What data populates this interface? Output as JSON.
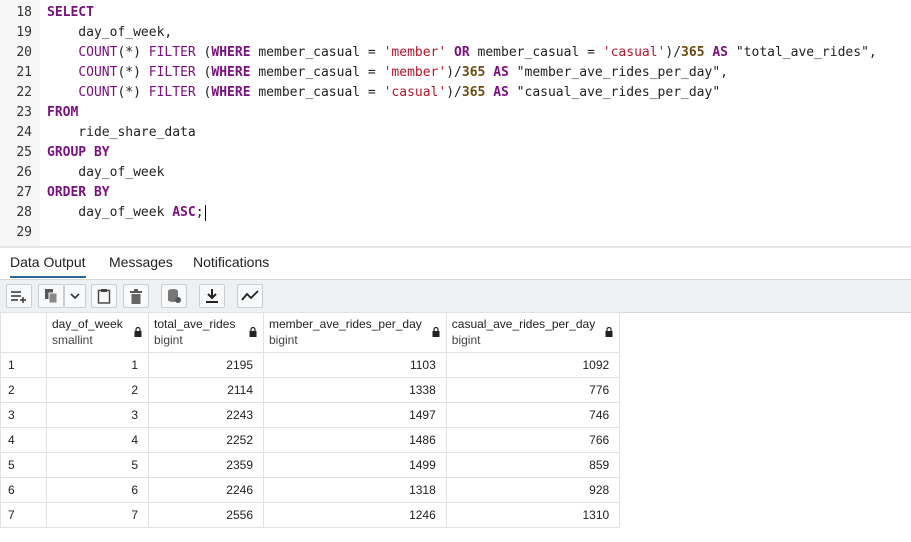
{
  "editor": {
    "lines": [
      {
        "n": "18",
        "parts": [
          {
            "t": "SELECT",
            "c": "kw"
          }
        ]
      },
      {
        "n": "19",
        "parts": [
          {
            "t": "    day_of_week,",
            "c": ""
          }
        ]
      },
      {
        "n": "20",
        "parts": [
          {
            "t": "    ",
            "c": ""
          },
          {
            "t": "COUNT",
            "c": "fn"
          },
          {
            "t": "(*) ",
            "c": ""
          },
          {
            "t": "FILTER",
            "c": "fn"
          },
          {
            "t": " (",
            "c": ""
          },
          {
            "t": "WHERE",
            "c": "kw"
          },
          {
            "t": " member_casual = ",
            "c": ""
          },
          {
            "t": "'member'",
            "c": "str"
          },
          {
            "t": " ",
            "c": ""
          },
          {
            "t": "OR",
            "c": "kw"
          },
          {
            "t": " member_casual = ",
            "c": ""
          },
          {
            "t": "'casual'",
            "c": "str"
          },
          {
            "t": ")/",
            "c": ""
          },
          {
            "t": "365",
            "c": "num"
          },
          {
            "t": " ",
            "c": ""
          },
          {
            "t": "AS",
            "c": "kw"
          },
          {
            "t": " \"total_ave_rides\",",
            "c": ""
          }
        ]
      },
      {
        "n": "21",
        "parts": [
          {
            "t": "    ",
            "c": ""
          },
          {
            "t": "COUNT",
            "c": "fn"
          },
          {
            "t": "(*) ",
            "c": ""
          },
          {
            "t": "FILTER",
            "c": "fn"
          },
          {
            "t": " (",
            "c": ""
          },
          {
            "t": "WHERE",
            "c": "kw"
          },
          {
            "t": " member_casual = ",
            "c": ""
          },
          {
            "t": "'member'",
            "c": "str"
          },
          {
            "t": ")/",
            "c": ""
          },
          {
            "t": "365",
            "c": "num"
          },
          {
            "t": " ",
            "c": ""
          },
          {
            "t": "AS",
            "c": "kw"
          },
          {
            "t": " \"member_ave_rides_per_day\",",
            "c": ""
          }
        ]
      },
      {
        "n": "22",
        "parts": [
          {
            "t": "    ",
            "c": ""
          },
          {
            "t": "COUNT",
            "c": "fn"
          },
          {
            "t": "(*) ",
            "c": ""
          },
          {
            "t": "FILTER",
            "c": "fn"
          },
          {
            "t": " (",
            "c": ""
          },
          {
            "t": "WHERE",
            "c": "kw"
          },
          {
            "t": " member_casual = ",
            "c": ""
          },
          {
            "t": "'casual'",
            "c": "str"
          },
          {
            "t": ")/",
            "c": ""
          },
          {
            "t": "365",
            "c": "num"
          },
          {
            "t": " ",
            "c": ""
          },
          {
            "t": "AS",
            "c": "kw"
          },
          {
            "t": " \"casual_ave_rides_per_day\"",
            "c": ""
          }
        ]
      },
      {
        "n": "23",
        "parts": [
          {
            "t": "FROM",
            "c": "kw"
          }
        ]
      },
      {
        "n": "24",
        "parts": [
          {
            "t": "    ride_share_data",
            "c": ""
          }
        ]
      },
      {
        "n": "25",
        "parts": [
          {
            "t": "GROUP BY",
            "c": "kw"
          }
        ]
      },
      {
        "n": "26",
        "parts": [
          {
            "t": "    day_of_week",
            "c": ""
          }
        ]
      },
      {
        "n": "27",
        "parts": [
          {
            "t": "ORDER BY",
            "c": "kw"
          }
        ]
      },
      {
        "n": "28",
        "parts": [
          {
            "t": "    day_of_week ",
            "c": ""
          },
          {
            "t": "ASC",
            "c": "kw"
          },
          {
            "t": ";",
            "c": ""
          }
        ],
        "cursor": true
      },
      {
        "n": "29",
        "parts": []
      }
    ]
  },
  "tabs": [
    {
      "label": "Data Output",
      "active": true
    },
    {
      "label": "Messages",
      "active": false
    },
    {
      "label": "Notifications",
      "active": false
    }
  ],
  "toolbar": {
    "buttons": [
      {
        "name": "add-row-button",
        "icon": "add-row-icon",
        "glyph": "≡+"
      },
      {
        "name": "copy-button",
        "icon": "copy-icon",
        "glyph": "⧉"
      },
      {
        "name": "copy-options-button",
        "icon": "chevron-down-icon",
        "glyph": "⌄"
      },
      {
        "name": "paste-button",
        "icon": "clipboard-icon",
        "glyph": "📋"
      },
      {
        "name": "delete-button",
        "icon": "trash-icon",
        "glyph": "🗑"
      },
      {
        "name": "save-data-button",
        "icon": "database-icon",
        "glyph": "⛁"
      },
      {
        "name": "download-button",
        "icon": "download-icon",
        "glyph": "⤓"
      },
      {
        "name": "graph-button",
        "icon": "line-graph-icon",
        "glyph": "⟋"
      }
    ]
  },
  "grid": {
    "columns": [
      {
        "name": "day_of_week",
        "type": "smallint"
      },
      {
        "name": "total_ave_rides",
        "type": "bigint"
      },
      {
        "name": "member_ave_rides_per_day",
        "type": "bigint"
      },
      {
        "name": "casual_ave_rides_per_day",
        "type": "bigint"
      }
    ],
    "rows": [
      {
        "rn": "1",
        "cells": [
          "1",
          "2195",
          "1103",
          "1092"
        ]
      },
      {
        "rn": "2",
        "cells": [
          "2",
          "2114",
          "1338",
          "776"
        ]
      },
      {
        "rn": "3",
        "cells": [
          "3",
          "2243",
          "1497",
          "746"
        ]
      },
      {
        "rn": "4",
        "cells": [
          "4",
          "2252",
          "1486",
          "766"
        ]
      },
      {
        "rn": "5",
        "cells": [
          "5",
          "2359",
          "1499",
          "859"
        ]
      },
      {
        "rn": "6",
        "cells": [
          "6",
          "2246",
          "1318",
          "928"
        ]
      },
      {
        "rn": "7",
        "cells": [
          "7",
          "2556",
          "1246",
          "1310"
        ]
      }
    ]
  },
  "colors": {
    "keyword": "#7a0f7f",
    "string": "#b5162b",
    "number": "#6b4b12",
    "active_tab": "#326690"
  }
}
